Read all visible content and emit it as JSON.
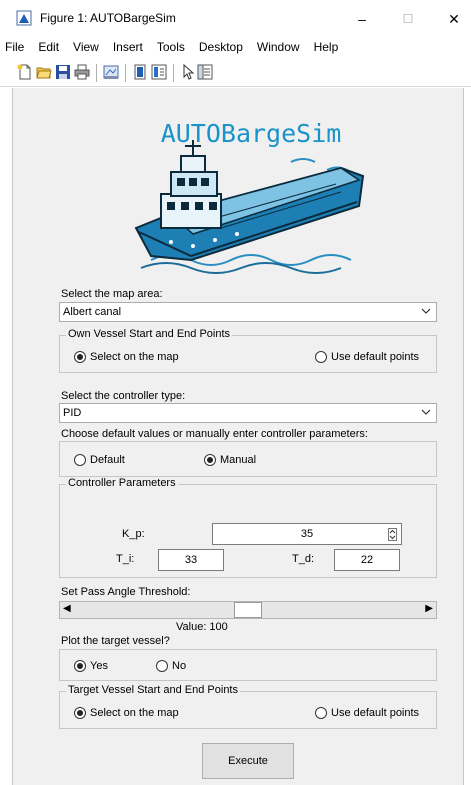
{
  "window": {
    "title": "Figure 1: AUTOBargeSim",
    "minimize": "–",
    "maximize": "☐",
    "close": "✕"
  },
  "menu": [
    "File",
    "Edit",
    "View",
    "Insert",
    "Tools",
    "Desktop",
    "Window",
    "Help"
  ],
  "toolbar_icons": [
    "new-figure-icon",
    "open-file-icon",
    "save-icon",
    "print-icon",
    "link-plot-icon",
    "hide-plot-tools-icon",
    "colorbar-icon",
    "edit-plot-icon",
    "property-inspector-icon"
  ],
  "banner": {
    "title": "AUTOBargeSim"
  },
  "map_area": {
    "label": "Select the map area:",
    "value": "Albert canal"
  },
  "own_points": {
    "title": "Own Vessel Start and End Points",
    "option_map": "Select on the map",
    "option_default": "Use default points",
    "selected": "map"
  },
  "controller": {
    "label": "Select the controller type:",
    "value": "PID"
  },
  "param_mode": {
    "label": "Choose default values or manually enter controller parameters:",
    "option_default": "Default",
    "option_manual": "Manual",
    "selected": "manual"
  },
  "params": {
    "title": "Controller Parameters",
    "kp_label": "K_p:",
    "kp_value": "35",
    "ti_label": "T_i:",
    "ti_value": "33",
    "td_label": "T_d:",
    "td_value": "22"
  },
  "pass_angle": {
    "label": "Set Pass Angle Threshold:",
    "value_text": "Value: 100",
    "slider_fraction": 0.5
  },
  "target_plot": {
    "label": "Plot the target vessel?",
    "option_yes": "Yes",
    "option_no": "No",
    "selected": "yes"
  },
  "target_points": {
    "title": "Target Vessel Start and End Points",
    "option_map": "Select on the map",
    "option_default": "Use default points",
    "selected": "map"
  },
  "execute": "Execute"
}
